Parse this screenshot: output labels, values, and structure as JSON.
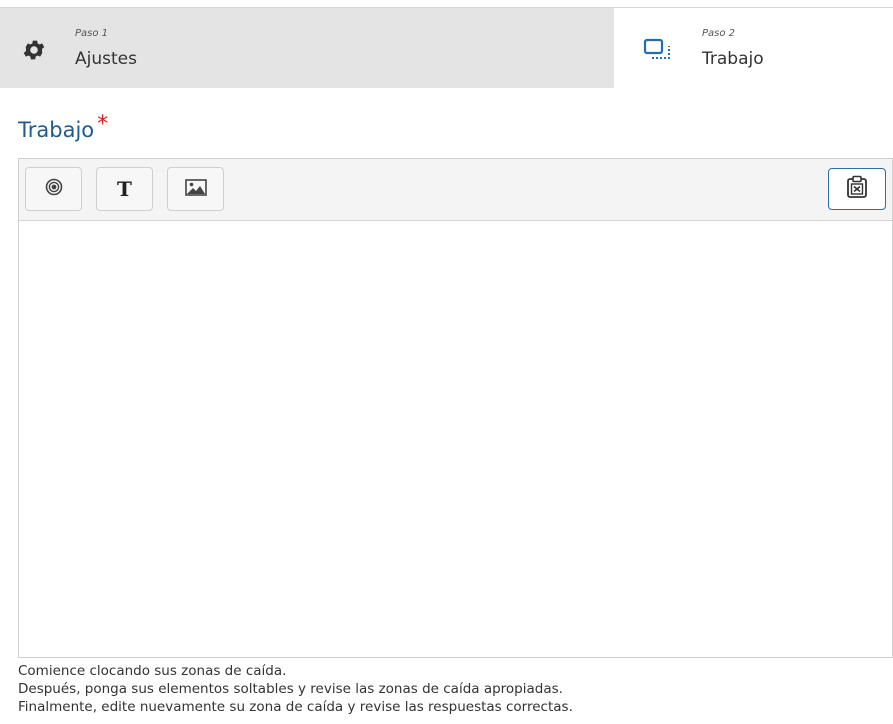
{
  "steps": [
    {
      "kicker": "Paso 1",
      "name": "Ajustes",
      "icon": "gear-icon",
      "active": false
    },
    {
      "kicker": "Paso 2",
      "name": "Trabajo",
      "icon": "drag-drop-icon",
      "active": true
    }
  ],
  "section": {
    "title": "Trabajo",
    "required_mark": "*"
  },
  "toolbar": {
    "buttons": [
      {
        "name": "hotspot-button",
        "icon": "target-icon"
      },
      {
        "name": "text-button",
        "label": "T",
        "icon": "text-icon"
      },
      {
        "name": "image-button",
        "icon": "image-icon"
      }
    ],
    "clear_button": {
      "name": "clear-button",
      "icon": "clipboard-x-icon"
    }
  },
  "instructions": [
    "Comience clocando sus zonas de caída.",
    "Después, ponga sus elementos soltables y revise las zonas de caída apropiadas.",
    "Finalmente, edite nuevamente su zona de caída y revise las respuestas correctas."
  ],
  "colors": {
    "accent": "#1f5a8e",
    "required": "#d21f1f",
    "tab_inactive_bg": "#e4e4e4",
    "clear_border": "#2a6fa8"
  }
}
